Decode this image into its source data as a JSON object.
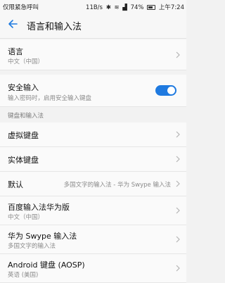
{
  "status_bar": {
    "left_text": "仅限紧急呼叫",
    "speed": "11B/s",
    "battery": "74%",
    "time": "上午7:24"
  },
  "header": {
    "title": "语言和输入法"
  },
  "language": {
    "title": "语言",
    "subtitle": "中文（中国）"
  },
  "secure_input": {
    "title": "安全输入",
    "subtitle": "输入密码时，启用安全输入键盘",
    "enabled": true
  },
  "section": {
    "label": "键盘和输入法"
  },
  "virtual_keyboard": {
    "title": "虚拟键盘"
  },
  "physical_keyboard": {
    "title": "实体键盘"
  },
  "default": {
    "title": "默认",
    "value": "多国文字的输入法 - 华为 Swype 输入法"
  },
  "baidu": {
    "title": "百度输入法华为版",
    "subtitle": "中文（中国）"
  },
  "swype": {
    "title": "华为 Swype 输入法",
    "subtitle": "多国文字的输入法"
  },
  "aosp": {
    "title": "Android 键盘 (AOSP)",
    "subtitle": "英语 (美国)"
  }
}
